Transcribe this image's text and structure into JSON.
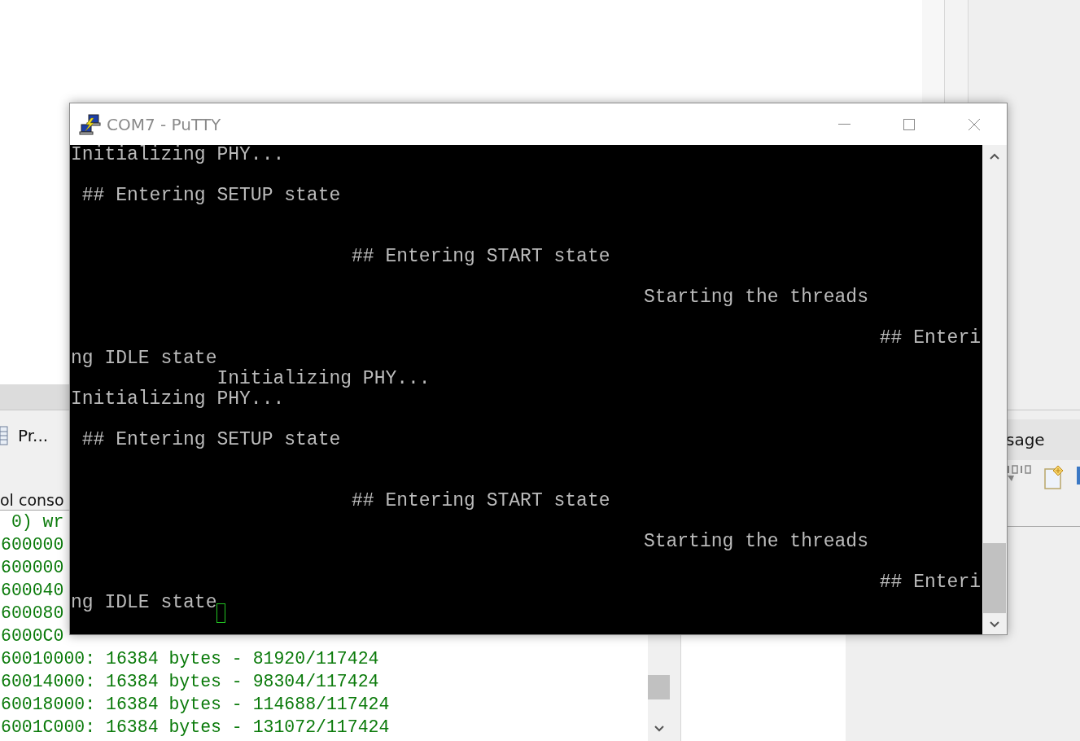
{
  "ide": {
    "tab": {
      "label": "Pr..."
    },
    "console": {
      "title": "ol conso",
      "lines": [
        " 0) wr",
        "600000",
        "600000",
        "600040",
        "600080",
        "6000C0",
        "60010000: 16384 bytes - 81920/117424",
        "60014000: 16384 bytes - 98304/117424",
        "60018000: 16384 bytes - 114688/117424",
        "6001C000: 16384 bytes - 131072/117424"
      ]
    },
    "right_view": {
      "title": "sage"
    }
  },
  "putty": {
    "title": "COM7 - PuTTY",
    "terminal_lines": [
      "Initializing PHY...",
      "\n ## Entering SETUP state",
      "\n\n                         ## Entering START state",
      "\n                                                   Starting the threads",
      "\n                                                                        ## Enteri",
      "ng IDLE state",
      "             Initializing PHY...",
      "Initializing PHY...",
      "\n ## Entering SETUP state",
      "\n\n                         ## Entering START state",
      "\n                                                   Starting the threads",
      "\n                                                                        ## Enteri",
      "ng IDLE state"
    ]
  }
}
